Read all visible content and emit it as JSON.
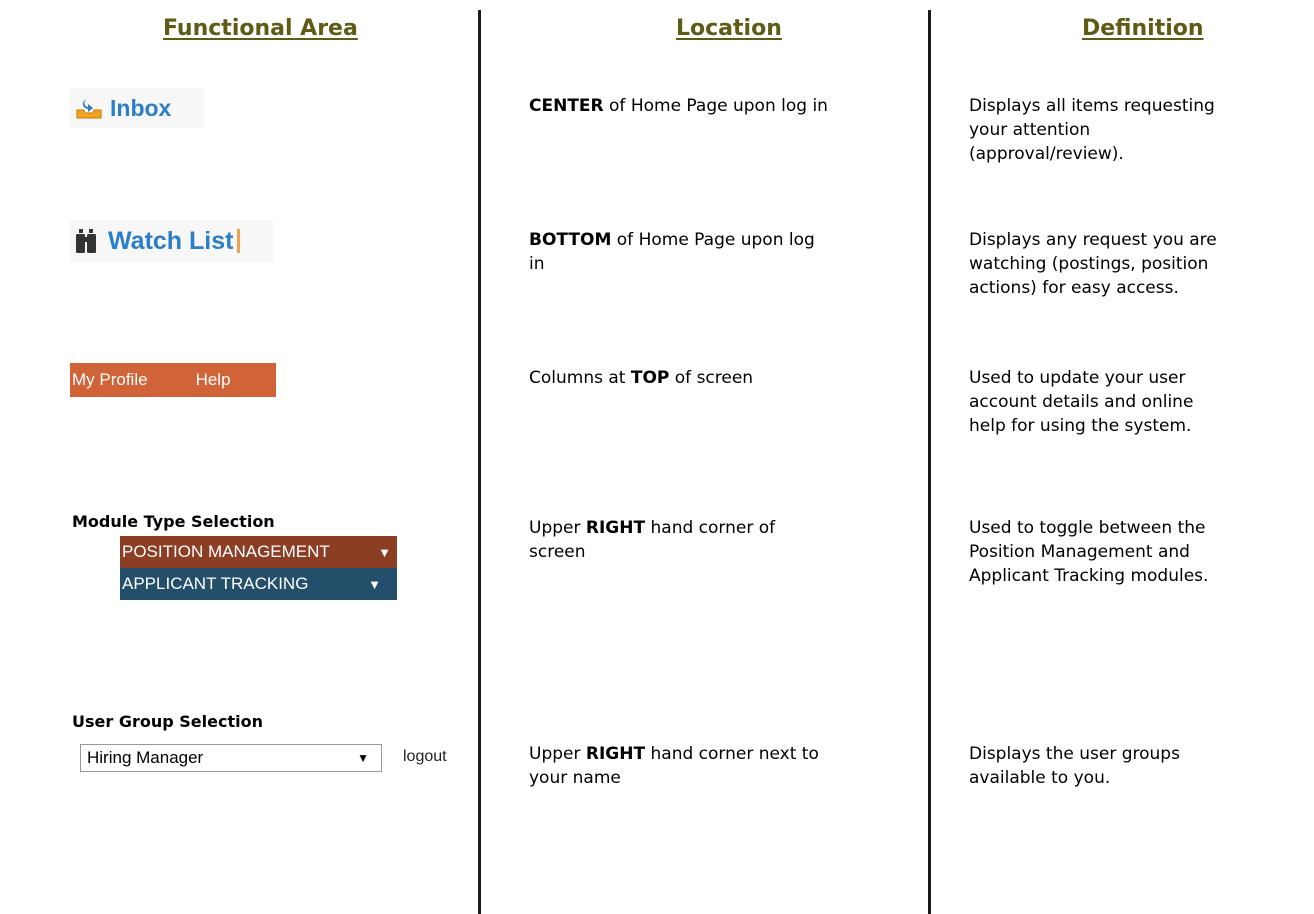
{
  "headers": {
    "functional_area": "Functional Area",
    "location": "Location",
    "definition": "Definition"
  },
  "rows": [
    {
      "area": {
        "type": "button",
        "label": "Inbox",
        "icon": "inbox-tray-icon",
        "label_color": "#2a7fc8"
      },
      "location": {
        "emphasis": "CENTER",
        "rest_line1": " of Home Page upon log in"
      },
      "definition": [
        "Displays all items requesting",
        "your attention",
        "(approval/review)."
      ]
    },
    {
      "area": {
        "type": "button",
        "label": "Watch List",
        "icon": "binoculars-icon",
        "label_color": "#2a7fc8"
      },
      "location": {
        "emphasis": "BOTTOM",
        "rest_line1": " of Home Page upon log",
        "line2": "in"
      },
      "definition": [
        "Displays any request you are",
        "watching (postings, position",
        "actions) for easy access."
      ]
    },
    {
      "area": {
        "type": "menu-bar",
        "items": [
          "My Profile",
          "Help"
        ],
        "bg": "#d06438"
      },
      "location": {
        "prefix": "Columns at ",
        "emphasis": "TOP",
        "rest_line1": " of screen"
      },
      "definition": [
        "Used to update your user",
        "account details and online",
        "help for using the system."
      ]
    },
    {
      "area": {
        "type": "module-select",
        "title": "Module Type Selection",
        "options": [
          {
            "label": "POSITION MANAGEMENT",
            "bg": "#8b3e24"
          },
          {
            "label": "APPLICANT TRACKING",
            "bg": "#244f6b"
          }
        ],
        "arrow": "▼"
      },
      "location": {
        "prefix": "Upper ",
        "emphasis": "RIGHT",
        "rest_line1": " hand corner of",
        "line2": "screen"
      },
      "definition": [
        "Used to toggle between the",
        "Position Management and",
        "Applicant Tracking modules."
      ]
    },
    {
      "area": {
        "type": "group-select",
        "title": "User Group Selection",
        "selected": "Hiring Manager",
        "arrow": "▼",
        "logout": "logout"
      },
      "location": {
        "prefix": "Upper ",
        "emphasis": "RIGHT",
        "rest_line1": " hand corner next to",
        "line2": "your name"
      },
      "definition": [
        "Displays the user groups",
        "available to you."
      ]
    }
  ],
  "colors": {
    "header_text": "#5f5a14",
    "divider": "#1a1a1a"
  }
}
